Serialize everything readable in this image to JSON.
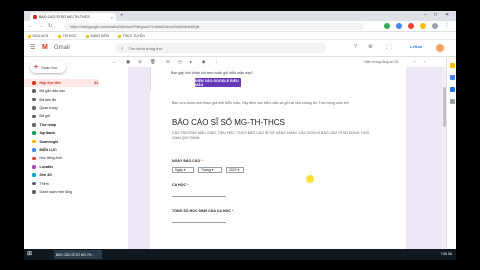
{
  "browser": {
    "tab_title": "BÁO CÁO SĨ SỐ MG-TH-THCS",
    "tab_close": "×",
    "new_tab": "+",
    "url": "https://mail.google.com/mail/u/0/#inbox/FMfcgxwJXLmhbwSdnrmGwblrMxfxDKjfs",
    "bookmarks": [
      "NGA LỊCH",
      "TIN HỌC",
      "SÁNG KIẾN",
      "TRỰC TUYẾN"
    ]
  },
  "gmail": {
    "logo_letter": "M",
    "brand": "Gmail",
    "search_placeholder": "Tìm kiếm trong thư",
    "org_badge": "LeSon",
    "compose_label": "Soạn thư",
    "sidebar": [
      {
        "label": "Hộp thư đến",
        "count": "84",
        "active": true,
        "bold": true,
        "color": "#d93025"
      },
      {
        "label": "Đã gắn dấu sao",
        "count": "",
        "color": "#5f6368"
      },
      {
        "label": "Đã tạm ẩn",
        "count": "",
        "color": "#5f6368"
      },
      {
        "label": "Quan trọng",
        "count": "",
        "color": "#5f6368"
      },
      {
        "label": "Đã gửi",
        "count": "",
        "color": "#5f6368"
      },
      {
        "label": "Thư nháp",
        "count": "",
        "bold": true,
        "color": "#5f6368"
      },
      {
        "label": "Agribank",
        "count": "",
        "bold": true,
        "color": "#0f9d58"
      },
      {
        "label": "Doanhnghi",
        "count": "",
        "bold": true,
        "color": "#f4b400"
      },
      {
        "label": "ĐIỆN LỰC",
        "count": "",
        "bold": true,
        "color": "#4285f4"
      },
      {
        "label": "Học tiếng Anh",
        "count": "",
        "color": "#db4437"
      },
      {
        "label": "Lovatiis",
        "count": "",
        "bold": true,
        "color": "#ab47bc"
      },
      {
        "label": "Sim 4G",
        "count": "",
        "bold": true,
        "color": "#00acc1"
      },
      {
        "label": "Thêm",
        "count": "",
        "color": "#5f6368"
      },
      {
        "label": "Danh sách mời tổng",
        "count": "",
        "color": "#5f6368"
      }
    ],
    "pager": "Hiện trong tổng số 26"
  },
  "email": {
    "question": "Bạn gặp khó khăn khi xem hoặc gửi biểu mẫu này?",
    "fill_button": "ĐIỀN VÀO GOOGLE BIỂU MẪU",
    "form_intro": "Bạn vừa được mời tham gia một biểu mẫu. Hãy điền vào biểu mẫu và gửi lại cho chúng tôi. Trân trọng cảm ơn!",
    "form_title": "BÁO CÁO SĨ SỐ MG-TH-THCS",
    "form_desc": "CÁC TRƯỜNG MẪU GIÁO, TIỂU HỌC, THCS BÁO CÁO SĨ SỐ HẰNG NGÀY. CÁC ĐƠN VỊ BÁO CÁO SĨ SỐ ĐÚNG THỜI GIAN QUY ĐỊNH.",
    "q1_label": "NGÀY BÁO CÁO",
    "q1_day": "Ngày",
    "q1_month": "Tháng",
    "q1_year": "2022",
    "q2_label": "CA HỌC",
    "q3_label": "TỔNG SỐ HỌC SINH CỦA CA HỌC",
    "required_mark": "*"
  },
  "taskbar": {
    "start": "⊞",
    "task_title": "BÁO CÁO SĨ SỐ MG-TH...",
    "clock": "7:58 SA"
  }
}
